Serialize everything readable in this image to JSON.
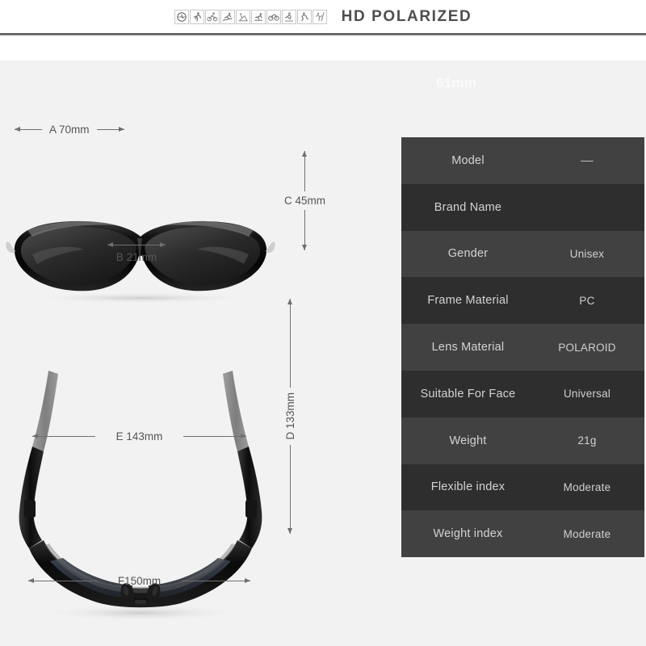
{
  "header": {
    "title": "HD POLARIZED",
    "sport_icons": [
      "clock-icon",
      "running-icon",
      "cycling-icon",
      "skiing-icon",
      "fishing-icon",
      "motorcycle-icon",
      "bicycle-icon",
      "golf-icon",
      "skating-icon",
      "climbing-icon"
    ]
  },
  "dimensions": {
    "lens_width_top": "61mm",
    "a": "A 70mm",
    "b": "B 21mm",
    "c": "C 45mm",
    "d": "D 133mm",
    "e": "E 143mm",
    "f": "F150mm"
  },
  "spec_table": {
    "rows": [
      {
        "label": "Model",
        "value": "––"
      },
      {
        "label": "Brand Name",
        "value": ""
      },
      {
        "label": "Gender",
        "value": "Unisex"
      },
      {
        "label": "Frame Material",
        "value": "PC"
      },
      {
        "label": "Lens Material",
        "value": "POLAROID"
      },
      {
        "label": "Suitable For Face",
        "value": "Universal"
      },
      {
        "label": "Weight",
        "value": "21g"
      },
      {
        "label": "Flexible index",
        "value": "Moderate"
      },
      {
        "label": "Weight index",
        "value": "Moderate"
      }
    ]
  },
  "colors": {
    "page_background": "#ffffff",
    "canvas_background": "#f2f2f2",
    "title_text": "#4e4e4e",
    "row_light": "#414141",
    "row_dark": "#2e2e2e",
    "spec_text": "#d3d3d3",
    "dimension_text": "#555555"
  }
}
